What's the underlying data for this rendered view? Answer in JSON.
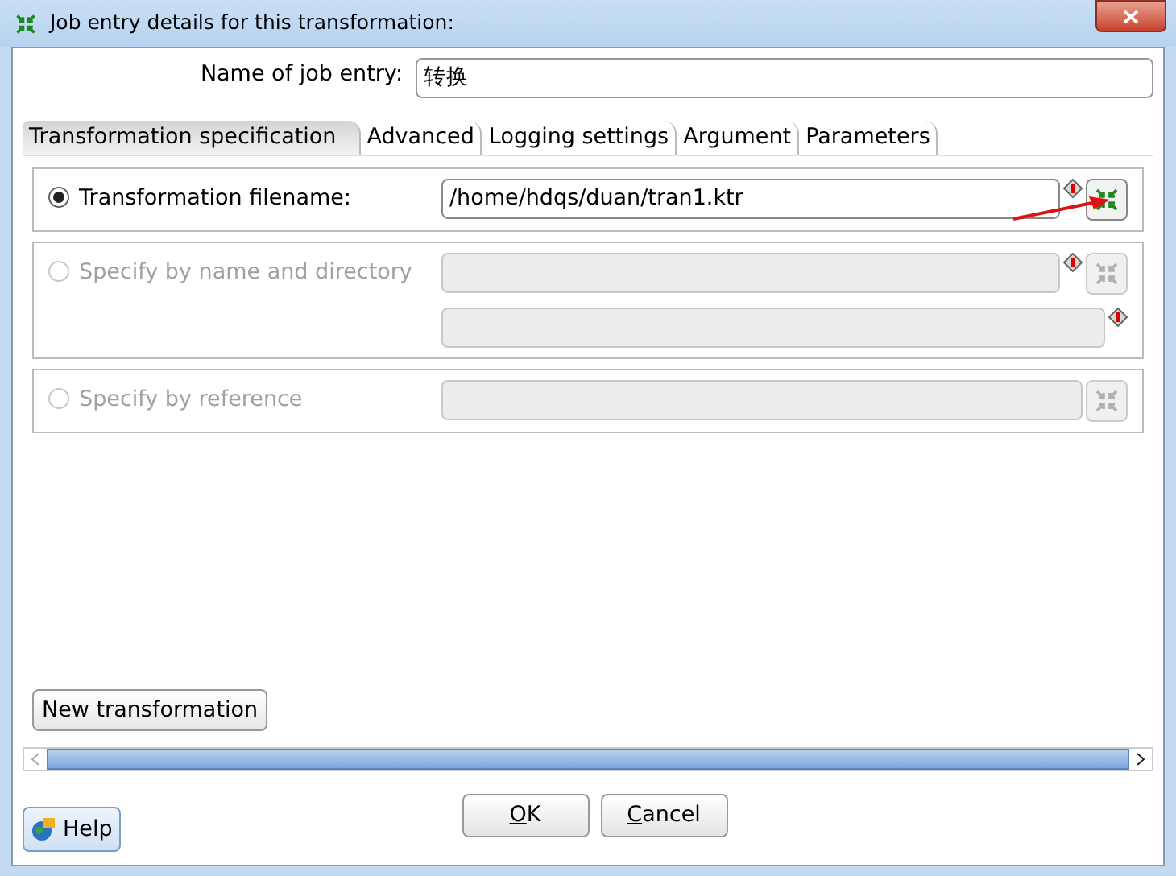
{
  "window": {
    "title": "Job entry details for this transformation:"
  },
  "name_field": {
    "label": "Name of job entry:",
    "value": "转换"
  },
  "tabs": [
    {
      "label": "Transformation specification",
      "selected": true
    },
    {
      "label": "Advanced",
      "selected": false
    },
    {
      "label": "Logging settings",
      "selected": false
    },
    {
      "label": "Argument",
      "selected": false
    },
    {
      "label": "Parameters",
      "selected": false
    }
  ],
  "options": [
    {
      "label": "Transformation filename:",
      "selected": true,
      "disabled": false,
      "fields": [
        {
          "value": "/home/hdqs/duan/tran1.ktr",
          "kind": "marker_browse"
        }
      ]
    },
    {
      "label": "Specify by name and directory",
      "selected": false,
      "disabled": true,
      "fields": [
        {
          "kind": "marker_browse"
        },
        {
          "kind": "marker"
        }
      ]
    },
    {
      "label": "Specify by reference",
      "selected": false,
      "disabled": true,
      "fields": [
        {
          "kind": "browse"
        }
      ]
    }
  ],
  "new_button": "New transformation",
  "buttons": [
    {
      "mnemonic": "O",
      "rest": "K"
    },
    {
      "mnemonic": "C",
      "rest": "ancel"
    }
  ],
  "help_button": "Help"
}
